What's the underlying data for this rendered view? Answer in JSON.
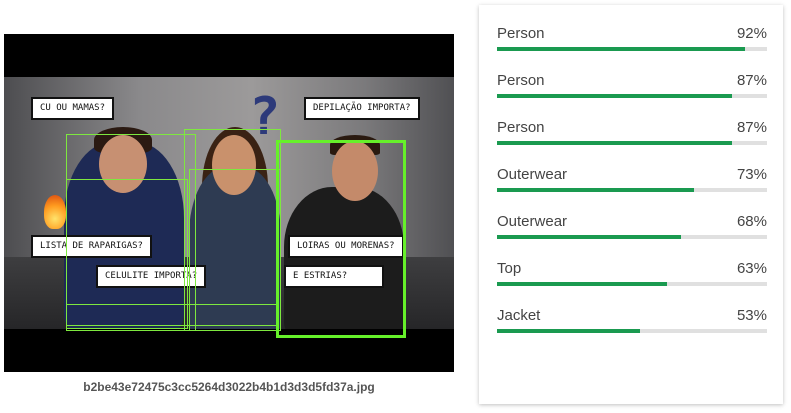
{
  "image": {
    "filename": "b2be43e72475c3cc5264d3022b4b1d3d3d5fd37a.jpg",
    "captions": {
      "cu_ou_mamas": "CU OU MAMAS?",
      "depilacao": "DEPILAÇÃO IMPORTA?",
      "lista": "LISTA DE RAPARIGAS?",
      "loiras": "LOIRAS OU MORENAS?",
      "celulite": "CELULITE IMPORTA?",
      "estrias": "E ESTRIAS?"
    }
  },
  "labels": [
    {
      "name": "Person",
      "percent_text": "92%",
      "score": 0.92
    },
    {
      "name": "Person",
      "percent_text": "87%",
      "score": 0.87
    },
    {
      "name": "Person",
      "percent_text": "87%",
      "score": 0.87
    },
    {
      "name": "Outerwear",
      "percent_text": "73%",
      "score": 0.73
    },
    {
      "name": "Outerwear",
      "percent_text": "68%",
      "score": 0.68
    },
    {
      "name": "Top",
      "percent_text": "63%",
      "score": 0.63
    },
    {
      "name": "Jacket",
      "percent_text": "53%",
      "score": 0.53
    }
  ],
  "colors": {
    "bar_fill": "#1a9a50",
    "bar_track": "#e0e0e0",
    "detection_box": "#7ee83f",
    "detection_box_active": "#66f02a"
  }
}
